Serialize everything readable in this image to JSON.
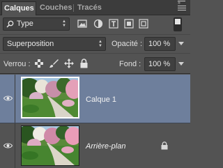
{
  "tabs": [
    {
      "label": "Calques",
      "active": true
    },
    {
      "label": "Couches",
      "active": false
    },
    {
      "label": "Tracés",
      "active": false
    }
  ],
  "filter": {
    "kind_label": "Type",
    "icons": [
      "image-filter-icon",
      "adjustment-filter-icon",
      "text-filter-icon",
      "shape-filter-icon",
      "smart-object-filter-icon"
    ]
  },
  "blend": {
    "mode": "Superposition",
    "opacity_label": "Opacité :",
    "opacity_value": "100 %"
  },
  "lock": {
    "label": "Verrou :",
    "icons": [
      "lock-transparent-pixels-icon",
      "lock-image-pixels-icon",
      "lock-position-icon",
      "lock-all-icon"
    ],
    "fill_label": "Fond :",
    "fill_value": "100 %"
  },
  "layers": [
    {
      "name": "Calque 1",
      "selected": true,
      "visible": true,
      "locked": false
    },
    {
      "name": "Arrière-plan",
      "selected": false,
      "visible": true,
      "locked": true
    }
  ],
  "colors": {
    "panel": "#535353",
    "selected_layer": "#6e7f9c"
  }
}
